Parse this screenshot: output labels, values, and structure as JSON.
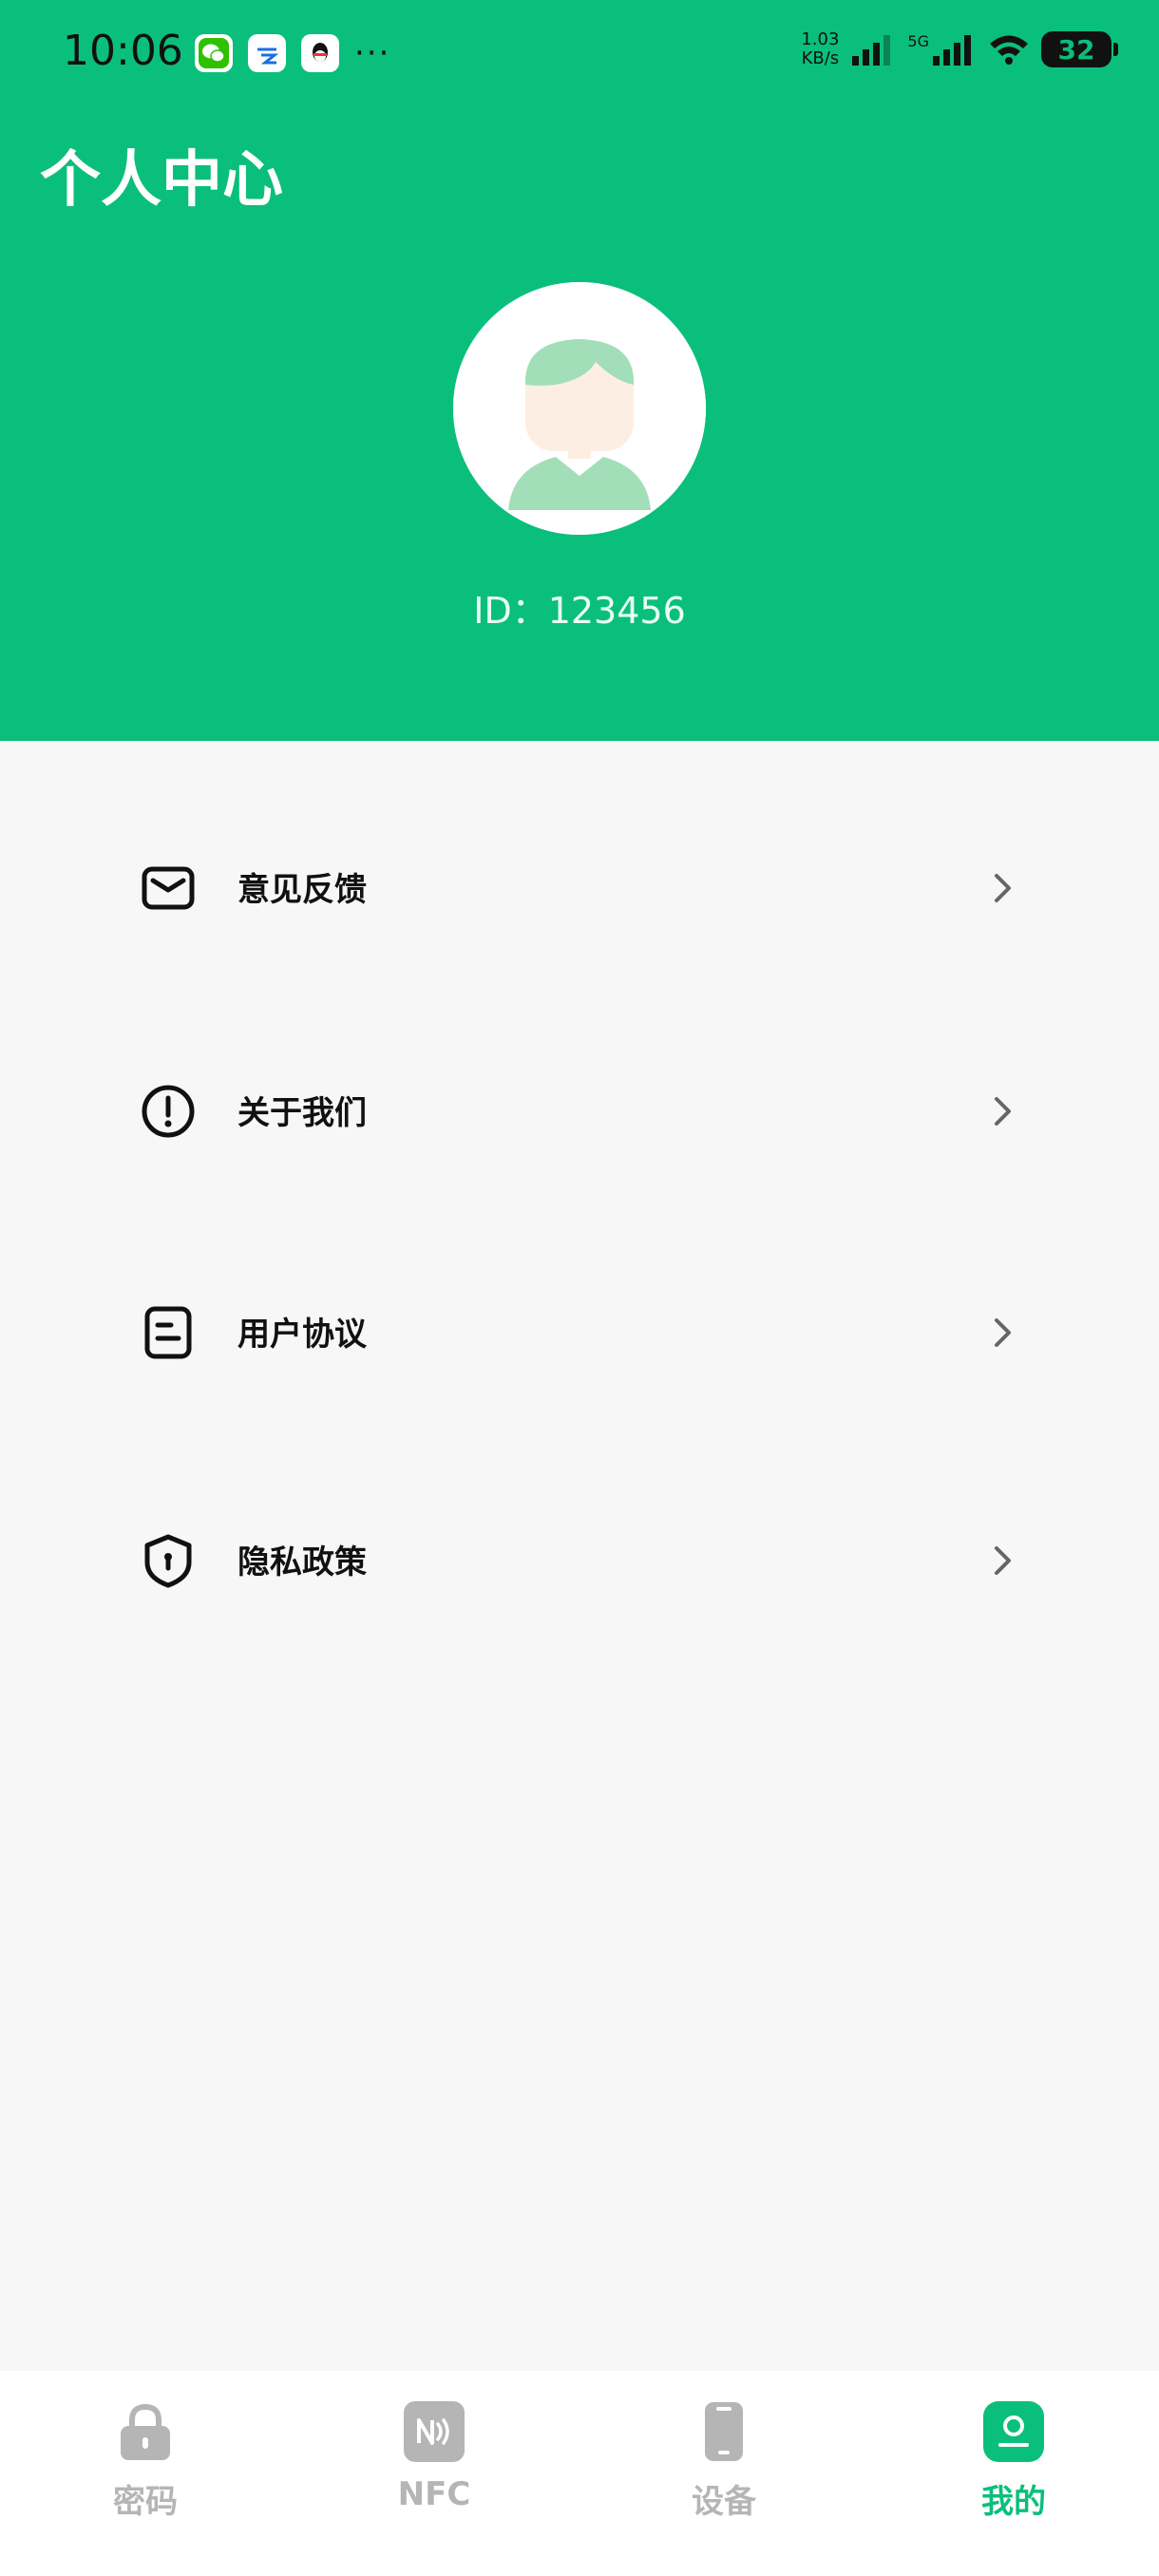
{
  "status_bar": {
    "time": "10:06",
    "net_speed_value": "1.03",
    "net_speed_unit": "KB/s",
    "network_type": "5G",
    "battery": "32",
    "more_icon": "···"
  },
  "header": {
    "title": "个人中心",
    "user_id": "ID：123456"
  },
  "menu": {
    "items": [
      {
        "label": "意见反馈",
        "icon": "mail-icon"
      },
      {
        "label": "关于我们",
        "icon": "info-icon"
      },
      {
        "label": "用户协议",
        "icon": "document-icon"
      },
      {
        "label": "隐私政策",
        "icon": "shield-icon"
      }
    ]
  },
  "bottom_nav": {
    "items": [
      {
        "label": "密码",
        "icon": "lock-icon",
        "active": false
      },
      {
        "label": "NFC",
        "icon": "nfc-icon",
        "active": false
      },
      {
        "label": "设备",
        "icon": "phone-icon",
        "active": false
      },
      {
        "label": "我的",
        "icon": "profile-icon",
        "active": true
      }
    ]
  },
  "colors": {
    "primary": "#0abf7c",
    "inactive": "#b5b5b5",
    "background": "#f7f7f7"
  }
}
